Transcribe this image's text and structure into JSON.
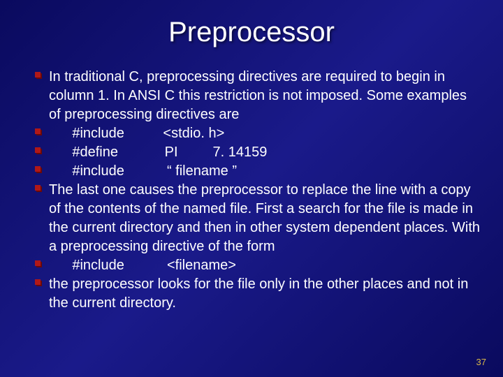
{
  "title": "Preprocessor",
  "items": [
    "In traditional C, preprocessing directives are required to begin in column 1. In ANSI C this restriction is not imposed. Some examples of preprocessing directives are",
    "      #include          <stdio. h>",
    "      #define            PI         7. 14159",
    "      #include           “ filename ”",
    "The last one causes the preprocessor to replace the line with a copy of the contents of the named file. First a search for the file is made in the current directory and then in other system dependent places. With a preprocessing directive of the form",
    "      #include           <filename>",
    "the preprocessor looks for the file only in the other places and not in the current directory."
  ],
  "page_number": "37"
}
